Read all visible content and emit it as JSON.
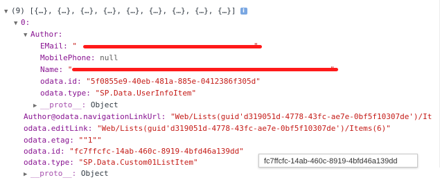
{
  "summary": {
    "prefix": "(9) ",
    "items": "[{…}, {…}, {…}, {…}, {…}, {…}, {…}, {…}, {…}]",
    "badge": "i"
  },
  "item0": {
    "index": "0:"
  },
  "author": {
    "key": "Author:",
    "email_key": "EMail:",
    "email_val": "\"",
    "email_end": "\"",
    "mobile_key": "MobilePhone:",
    "mobile_val": "null",
    "name_key": "Name:",
    "name_val": "\"",
    "name_end": "\"",
    "odata_id_key": "odata.id:",
    "odata_id_val": "\"5f0855e9-40eb-481a-885e-0412386f305d\"",
    "odata_type_key": "odata.type:",
    "odata_type_val": "\"SP.Data.UserInfoItem\"",
    "proto_key": "__proto__:",
    "proto_val": "Object"
  },
  "fields": {
    "nav_key": "Author@odata.navigationLinkUrl:",
    "nav_val": "\"Web/Lists(guid'd319051d-4778-43fc-ae7e-0bf5f10307de')/It",
    "edit_key": "odata.editLink:",
    "edit_val": "\"Web/Lists(guid'd319051d-4778-43fc-ae7e-0bf5f10307de')/Items(6)\"",
    "etag_key": "odata.etag:",
    "etag_val": "\"\"1\"\"",
    "id_key": "odata.id:",
    "id_val": "\"fc7ffcfc-14ab-460c-8919-4bfd46a139dd\"",
    "type_key": "odata.type:",
    "type_val": "\"SP.Data.Custom01ListItem\"",
    "proto_key": "__proto__:",
    "proto_val": "Object"
  },
  "tooltip": {
    "text": "fc7ffcfc-14ab-460c-8919-4bfd46a139dd"
  },
  "colors": {
    "key": "#881391",
    "string": "#c41a16",
    "redaction": "#ff1a1a"
  }
}
